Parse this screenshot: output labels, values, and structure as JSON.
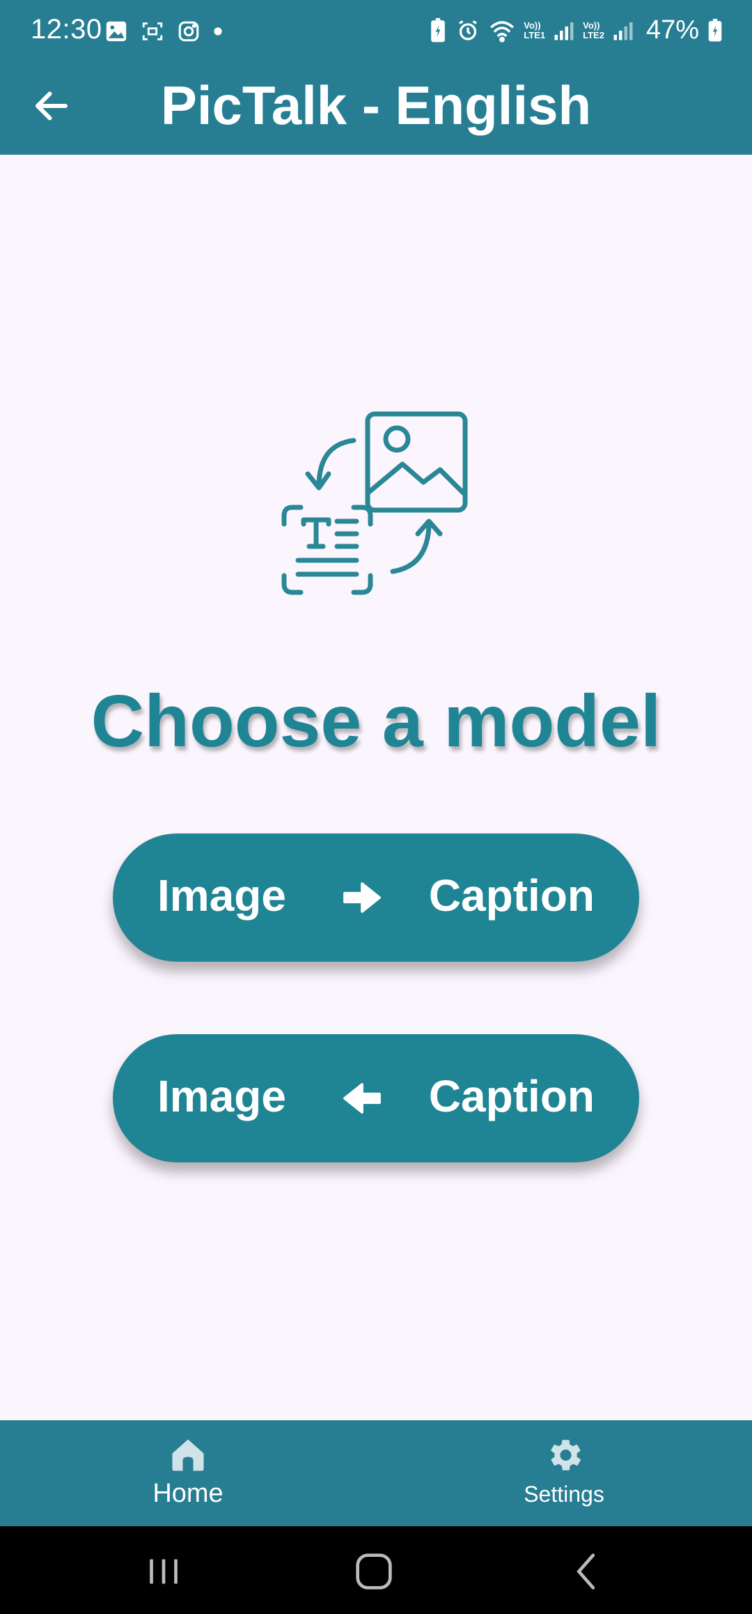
{
  "status_bar": {
    "time": "12:30",
    "left_icons": [
      "gallery-icon",
      "screenshot-icon",
      "instagram-icon",
      "dot-icon"
    ],
    "right_icons": [
      "battery-saver-icon",
      "alarm-icon",
      "wifi-icon",
      "signal-sim1-icon",
      "signal-sim2-icon",
      "battery-charging-icon"
    ],
    "sim1_label": [
      "Vo))",
      "LTE1"
    ],
    "sim2_label": [
      "Vo))",
      "LTE2"
    ],
    "battery": "47%"
  },
  "app_bar": {
    "title": "PicTalk - English",
    "back_icon": "arrow-left-icon"
  },
  "hero": {
    "icon": "image-text-convert-icon"
  },
  "heading": "Choose a model",
  "buttons": [
    {
      "left": "Image",
      "right": "Caption",
      "arrow": "arrow-right-icon"
    },
    {
      "left": "Image",
      "right": "Caption",
      "arrow": "arrow-left-icon"
    }
  ],
  "bottom_nav": {
    "items": [
      {
        "label": "Home",
        "icon": "home-icon",
        "selected": true
      },
      {
        "label": "Settings",
        "icon": "settings-icon",
        "selected": false
      }
    ]
  },
  "colors": {
    "primary": "#277e93",
    "button": "#1f8494",
    "background": "#fbf5fd",
    "text_on_primary": "#ffffff"
  }
}
